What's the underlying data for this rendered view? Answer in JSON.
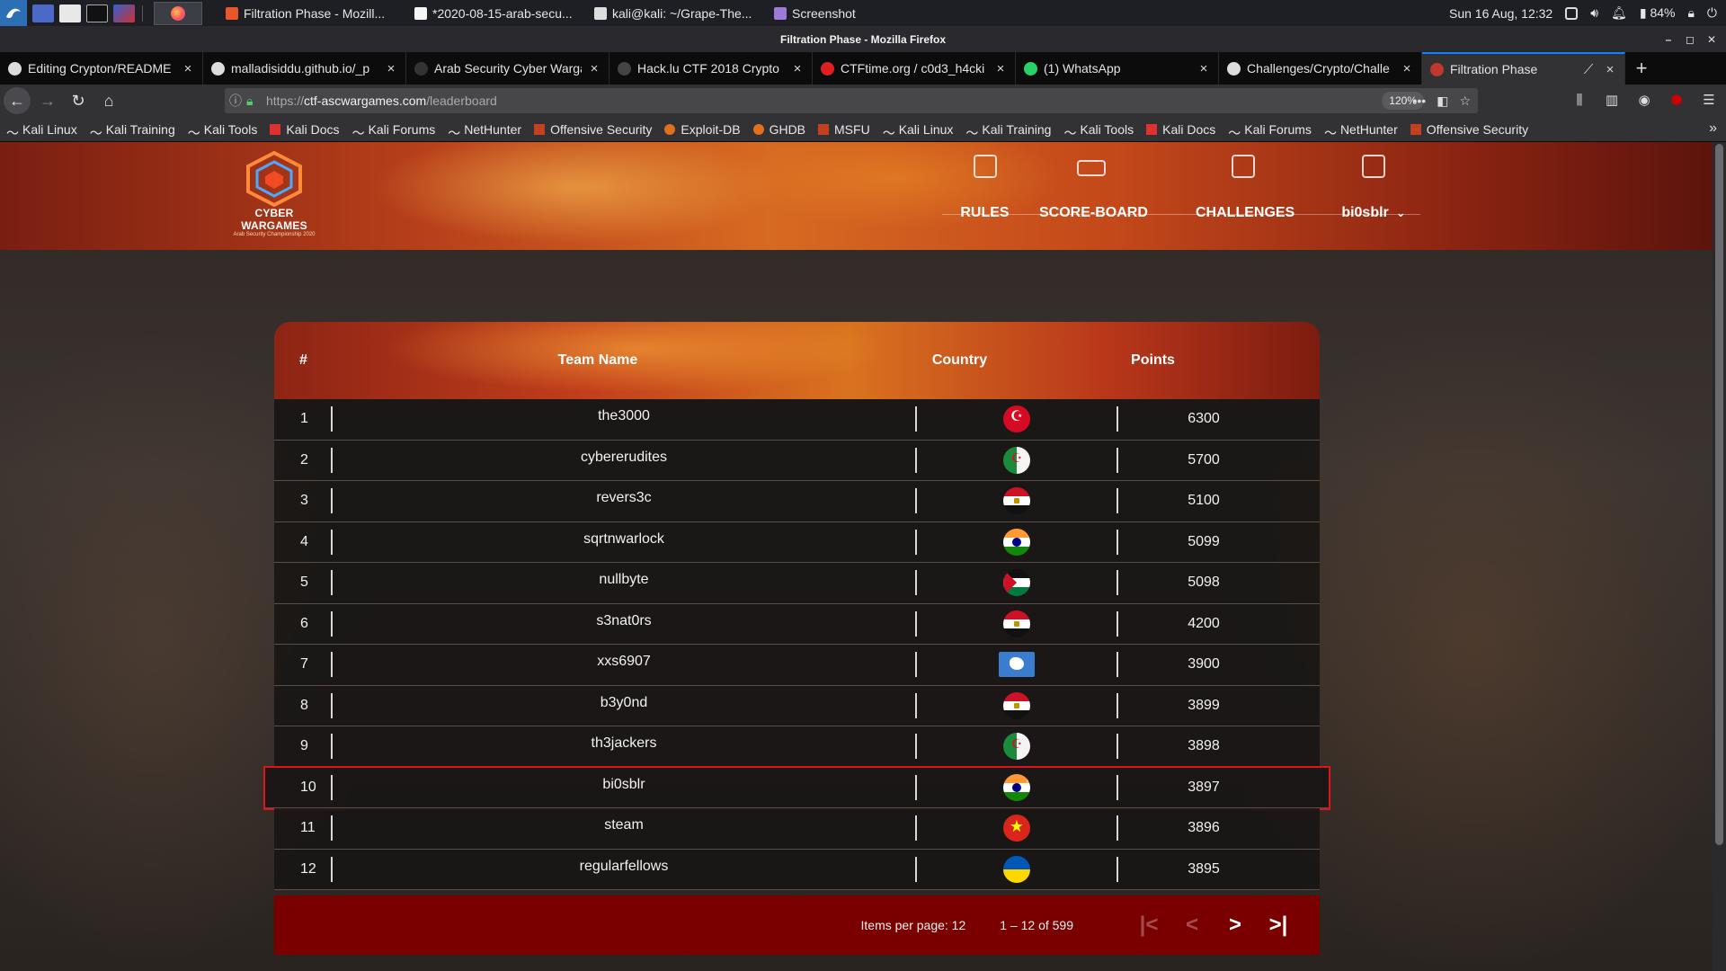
{
  "system_panel": {
    "tasks": [
      {
        "label": "Filtration Phase - Mozill...",
        "color": "#e8562a"
      },
      {
        "label": "*2020-08-15-arab-secu...",
        "color": "#f5f5f5"
      },
      {
        "label": "kali@kali: ~/Grape-The...",
        "color": "#dddddd"
      },
      {
        "label": "Screenshot",
        "color": "#9b7bd6"
      }
    ],
    "clock": "Sun 16 Aug, 12:32",
    "battery": "84%"
  },
  "window_title": "Filtration Phase - Mozilla Firefox",
  "tabs": [
    {
      "label": "Editing Crypton/README",
      "color": "#dddddd"
    },
    {
      "label": "malladisiddu.github.io/_p",
      "color": "#dddddd"
    },
    {
      "label": "Arab Security Cyber Wargan",
      "color": "#333333"
    },
    {
      "label": "Hack.lu CTF 2018 Crypto",
      "color": "#444444"
    },
    {
      "label": "CTFtime.org / c0d3_h4cki",
      "color": "#e02020"
    },
    {
      "label": "(1) WhatsApp",
      "color": "#25d366"
    },
    {
      "label": "Challenges/Crypto/Challe",
      "color": "#dddddd"
    },
    {
      "label": "Filtration Phase",
      "color": "#c0392b"
    }
  ],
  "url": {
    "prefix": "https://",
    "host": "ctf-ascwargames.com",
    "path": "/leaderboard",
    "zoom": "120%"
  },
  "bookmarks": [
    {
      "label": "Kali Linux",
      "color": "#b0b0b0"
    },
    {
      "label": "Kali Training",
      "color": "#b0b0b0"
    },
    {
      "label": "Kali Tools",
      "color": "#b0b0b0"
    },
    {
      "label": "Kali Docs",
      "color": "#e03030"
    },
    {
      "label": "Kali Forums",
      "color": "#b0b0b0"
    },
    {
      "label": "NetHunter",
      "color": "#b0b0b0"
    },
    {
      "label": "Offensive Security",
      "color": "#c04020"
    },
    {
      "label": "Exploit-DB",
      "color": "#e07020"
    },
    {
      "label": "GHDB",
      "color": "#e07020"
    },
    {
      "label": "MSFU",
      "color": "#c04020"
    },
    {
      "label": "Kali Linux",
      "color": "#b0b0b0"
    },
    {
      "label": "Kali Training",
      "color": "#b0b0b0"
    },
    {
      "label": "Kali Tools",
      "color": "#b0b0b0"
    },
    {
      "label": "Kali Docs",
      "color": "#e03030"
    },
    {
      "label": "Kali Forums",
      "color": "#b0b0b0"
    },
    {
      "label": "NetHunter",
      "color": "#b0b0b0"
    },
    {
      "label": "Offensive Security",
      "color": "#c04020"
    }
  ],
  "site": {
    "logo_text": "CYBER WARGAMES",
    "logo_subtext": "Arab Security Championship 2020",
    "nav": {
      "rules": "RULES",
      "scoreboard": "SCORE-BOARD",
      "challenges": "CHALLENGES",
      "user": "bi0sblr"
    }
  },
  "leaderboard": {
    "headers": {
      "rank": "#",
      "team": "Team Name",
      "country": "Country",
      "points": "Points"
    },
    "highlight_rank": 10,
    "rows": [
      {
        "rank": "1",
        "team": "the3000",
        "flag": "tn",
        "points": "6300"
      },
      {
        "rank": "2",
        "team": "cybererudites",
        "flag": "dz",
        "points": "5700"
      },
      {
        "rank": "3",
        "team": "revers3c",
        "flag": "eg",
        "points": "5100"
      },
      {
        "rank": "4",
        "team": "sqrtnwarlock",
        "flag": "in",
        "points": "5099"
      },
      {
        "rank": "5",
        "team": "nullbyte",
        "flag": "jo",
        "points": "5098"
      },
      {
        "rank": "6",
        "team": "s3nat0rs",
        "flag": "eg",
        "points": "4200"
      },
      {
        "rank": "7",
        "team": "xxs6907",
        "flag": "aq",
        "points": "3900"
      },
      {
        "rank": "8",
        "team": "b3y0nd",
        "flag": "eg",
        "points": "3899"
      },
      {
        "rank": "9",
        "team": "th3jackers",
        "flag": "dz",
        "points": "3898"
      },
      {
        "rank": "10",
        "team": "bi0sblr",
        "flag": "in",
        "points": "3897"
      },
      {
        "rank": "11",
        "team": "steam",
        "flag": "vn",
        "points": "3896"
      },
      {
        "rank": "12",
        "team": "regularfellows",
        "flag": "ua",
        "points": "3895"
      }
    ],
    "pagination": {
      "items_per_page_label": "Items per page: 12",
      "range_label": "1 – 12 of 599"
    }
  }
}
